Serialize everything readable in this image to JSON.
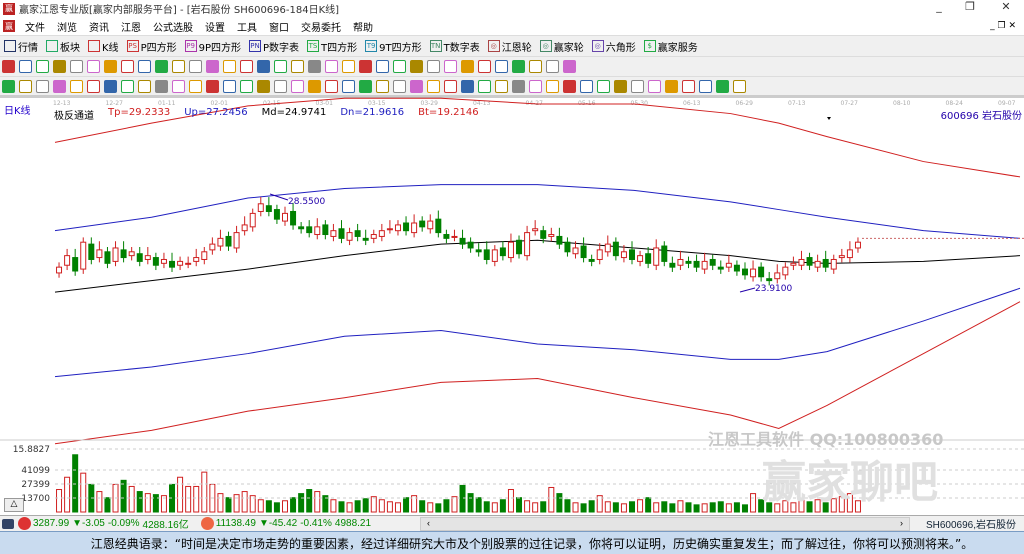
{
  "window": {
    "title": "赢家江恩专业版[赢家内部服务平台] - [岩石股份  SH600696-184日K线]",
    "min": "_",
    "restore": "❐",
    "close": "✕"
  },
  "menu": [
    "文件",
    "浏览",
    "资讯",
    "江恩",
    "公式选股",
    "设置",
    "工具",
    "窗口",
    "交易委托",
    "帮助"
  ],
  "toolbar1": [
    {
      "label": "行情",
      "icon": "quote-grid-icon",
      "c": "#236"
    },
    {
      "label": "板块",
      "icon": "sector-blocks-icon",
      "c": "#2a6"
    },
    {
      "label": "K线",
      "icon": "kline-icon",
      "c": "#c33"
    },
    {
      "label": "P四方形",
      "icon": "ps-icon",
      "c": "#c33",
      "t": "PS"
    },
    {
      "label": "9P四方形",
      "icon": "p9-icon",
      "c": "#a3a",
      "t": "P9"
    },
    {
      "label": "P数字表",
      "icon": "pn-icon",
      "c": "#33a",
      "t": "PN"
    },
    {
      "label": "T四方形",
      "icon": "ts-icon",
      "c": "#2a4",
      "t": "TS"
    },
    {
      "label": "9T四方形",
      "icon": "t9-icon",
      "c": "#28a",
      "t": "T9"
    },
    {
      "label": "T数字表",
      "icon": "tn-icon",
      "c": "#486",
      "t": "TN"
    },
    {
      "label": "江恩轮",
      "icon": "gann-wheel-icon",
      "c": "#a44",
      "t": "◎"
    },
    {
      "label": "赢家轮",
      "icon": "winner-wheel-icon",
      "c": "#486",
      "t": "◎"
    },
    {
      "label": "六角形",
      "icon": "hexagon-icon",
      "c": "#64a",
      "t": "◎"
    },
    {
      "label": "赢家服务",
      "icon": "dollar-icon",
      "c": "#2a4",
      "t": "$"
    }
  ],
  "chart": {
    "period_label": "日K线",
    "indicator_name": "极反通道",
    "tp": "Tp=29.2333",
    "up": "Up=27.2456",
    "md": "Md=24.9741",
    "dn": "Dn=21.9616",
    "bt": "Bt=19.2146",
    "stock_label": "600696 岩石股份",
    "colors": {
      "tp": "#d02020",
      "up": "#2020c0",
      "md": "#000000",
      "dn": "#2020c0",
      "bt": "#d02020",
      "up_candle": "#d02020",
      "down_candle": "#008000"
    },
    "high_label": "28.5500",
    "low_label": "23.9100",
    "vol_axis": [
      "15.8827",
      "41099",
      "27399",
      "13700"
    ],
    "watermark": "江恩工具软件  QQ:100800360",
    "watermark2": "赢家聊吧"
  },
  "chart_data": {
    "type": "candlestick",
    "date_ticks": [
      "12-13",
      "12-27",
      "01-11",
      "02-01",
      "02-15",
      "03-01",
      "03-15",
      "03-29",
      "04-13",
      "04-27",
      "05-16",
      "05-30",
      "06-13",
      "06-29",
      "07-13",
      "07-27",
      "08-10",
      "08-24",
      "09-07"
    ],
    "closes": [
      25.0,
      25.6,
      24.8,
      26.3,
      25.4,
      25.9,
      25.2,
      26.0,
      25.5,
      25.8,
      25.3,
      25.6,
      25.1,
      25.4,
      25.0,
      25.3,
      25.2,
      25.5,
      25.8,
      26.2,
      26.5,
      26.1,
      26.8,
      27.2,
      27.8,
      28.3,
      27.9,
      27.5,
      27.8,
      27.2,
      27.0,
      26.8,
      27.1,
      26.7,
      26.9,
      26.5,
      26.8,
      26.6,
      26.4,
      26.7,
      26.9,
      27.0,
      27.2,
      26.9,
      27.3,
      27.1,
      27.4,
      26.8,
      26.5,
      26.6,
      26.2,
      26.0,
      25.8,
      25.4,
      25.9,
      25.6,
      26.3,
      25.7,
      26.8,
      27.0,
      26.5,
      26.7,
      26.2,
      25.8,
      26.0,
      25.5,
      25.3,
      25.9,
      26.2,
      25.6,
      25.8,
      25.4,
      25.6,
      25.2,
      26.0,
      25.3,
      25.0,
      25.4,
      25.2,
      25.0,
      25.3,
      25.1,
      24.9,
      25.2,
      24.8,
      24.6,
      24.9,
      24.5,
      24.3,
      24.7,
      25.0,
      25.2,
      25.4,
      25.1,
      25.3,
      25.0,
      25.4,
      25.6,
      25.9,
      26.3
    ],
    "volumes": [
      22,
      34,
      56,
      38,
      27,
      20,
      14,
      27,
      31,
      25,
      20,
      18,
      17,
      16,
      27,
      34,
      25,
      25,
      39,
      27,
      18,
      14,
      17,
      20,
      16,
      12,
      11,
      9,
      11,
      14,
      18,
      22,
      20,
      16,
      12,
      10,
      9,
      11,
      13,
      15,
      12,
      10,
      9,
      14,
      16,
      11,
      9,
      8,
      12,
      15,
      26,
      18,
      14,
      10,
      9,
      12,
      22,
      14,
      11,
      9,
      10,
      24,
      18,
      12,
      9,
      8,
      11,
      16,
      10,
      9,
      8,
      10,
      12,
      14,
      9,
      10,
      8,
      11,
      9,
      7,
      8,
      9,
      10,
      8,
      9,
      7,
      18,
      12,
      9,
      8,
      11,
      9,
      13,
      10,
      12,
      9,
      13,
      15,
      18,
      11
    ],
    "bands": {
      "x_frac": [
        0,
        0.1,
        0.2,
        0.3,
        0.4,
        0.5,
        0.6,
        0.7,
        0.75,
        0.8,
        0.9,
        1
      ],
      "tp": [
        31.5,
        32.5,
        33.4,
        33.8,
        33.8,
        33.5,
        33.5,
        33.0,
        32.5,
        31.8,
        30.5,
        29.7
      ],
      "up": [
        26.9,
        27.6,
        28.6,
        29.1,
        29.3,
        29.3,
        29.0,
        28.4,
        28.0,
        27.6,
        26.9,
        26.5
      ],
      "md": [
        23.7,
        24.3,
        24.9,
        25.6,
        26.2,
        26.4,
        26.0,
        25.6,
        25.3,
        25.2,
        25.3,
        25.6
      ],
      "dn": [
        19.3,
        19.8,
        20.5,
        21.4,
        21.7,
        21.0,
        20.7,
        20.2,
        20.2,
        20.6,
        22.2,
        23.9
      ],
      "bt": [
        15.8,
        16.5,
        17.5,
        18.2,
        19.0,
        19.2,
        18.2,
        17.3,
        16.6,
        17.8,
        20.5,
        23.2
      ]
    }
  },
  "status": {
    "sh_index": "3287.99",
    "sh_change": "▼-3.05",
    "sh_pct": "-0.09%",
    "sh_amount": "4288.16亿",
    "sz_index": "11138.49",
    "sz_change": "▼-45.42",
    "sz_pct": "-0.41%",
    "sz_amount": "4988.21",
    "stock": "SH600696,岩石股份"
  },
  "quote": "江恩经典语录：“时间是决定市场走势的重要因素，经过详细研究大市及个别股票的过往记录，你将可以证明，历史确实重复发生；而了解过往，你将可以预测将来。”。"
}
